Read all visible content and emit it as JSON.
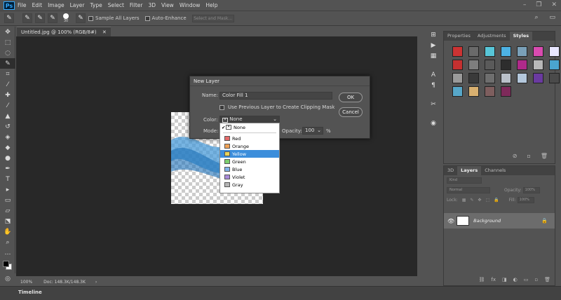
{
  "app": {
    "logo": "Ps"
  },
  "menu": [
    "File",
    "Edit",
    "Image",
    "Layer",
    "Type",
    "Select",
    "Filter",
    "3D",
    "View",
    "Window",
    "Help"
  ],
  "options": {
    "brush_size": "30",
    "sample_all_layers": "Sample All Layers",
    "auto_enhance": "Auto-Enhance",
    "select_mask": "Select and Mask..."
  },
  "document": {
    "tab": "Untitled.jpg @ 100% (RGB/8#)",
    "zoom": "100%",
    "doc_size": "Doc: 148.3K/148.3K"
  },
  "timeline": "Timeline",
  "panels": {
    "properties": "Properties",
    "adjustments": "Adjustments",
    "styles": "Styles",
    "three_d": "3D",
    "layers": "Layers",
    "channels": "Channels"
  },
  "layers": {
    "kind": "Kind",
    "blend": "Normal",
    "opacity_label": "Opacity:",
    "opacity": "100%",
    "lock_label": "Lock:",
    "fill_label": "Fill:",
    "fill": "100%",
    "background": "Background"
  },
  "dialog": {
    "title": "New Layer",
    "name_label": "Name:",
    "name_value": "Color Fill 1",
    "clip_label": "Use Previous Layer to Create Clipping Mask",
    "color_label": "Color:",
    "color_value": "None",
    "mode_label": "Mode:",
    "opacity_label": "Opacity:",
    "opacity_value": "100",
    "pct": "%",
    "ok": "OK",
    "cancel": "Cancel"
  },
  "dropdown": {
    "none": "None",
    "colors": [
      {
        "label": "Red",
        "color": "#e46a6a"
      },
      {
        "label": "Orange",
        "color": "#f0a256"
      },
      {
        "label": "Yellow",
        "color": "#e8d45a"
      },
      {
        "label": "Green",
        "color": "#7ccf6e"
      },
      {
        "label": "Blue",
        "color": "#7fb2e8"
      },
      {
        "label": "Violet",
        "color": "#a98ad9"
      },
      {
        "label": "Gray",
        "color": "#b5b5b5"
      }
    ],
    "selected": "Yellow"
  },
  "styles_swatches": [
    "#cc3333",
    "#6a6a6a",
    "#58c6d8",
    "#4db2e4",
    "#7aa0b8",
    "#d94bb0",
    "#e8e6ff",
    "#c43030",
    "#7e7e7e",
    "#5a5a5a",
    "#2d2d2d",
    "#b02a8a",
    "#b8b8b8",
    "#4aa5d0",
    "#9a9a9a",
    "#3a3a3a",
    "#6e6e6e",
    "#b9c0c9",
    "#b4c8dc",
    "#6a3aa0",
    "#4a4a4a",
    "#57a7c9",
    "#d9b070",
    "#7e5e5e",
    "#7e2a5a"
  ]
}
